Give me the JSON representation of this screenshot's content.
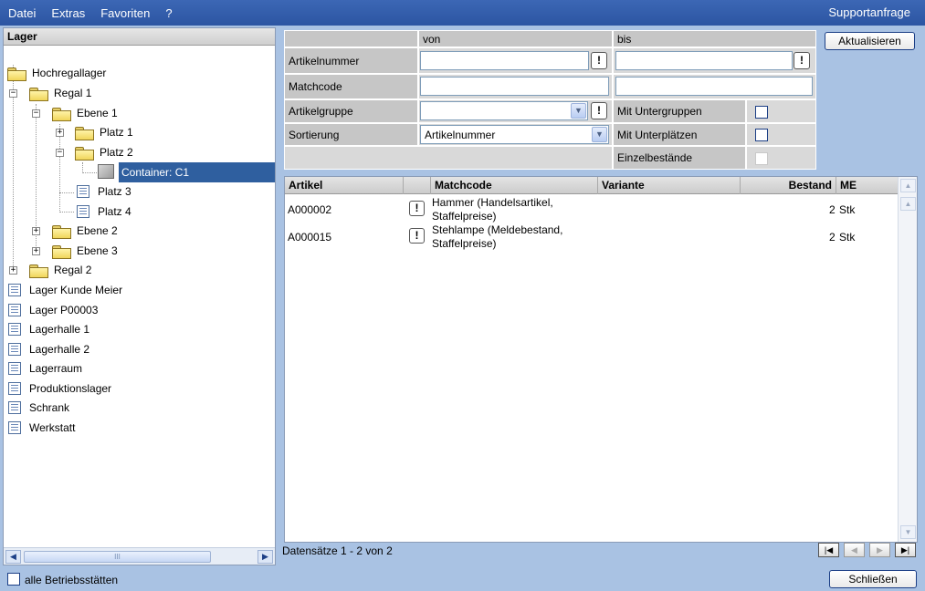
{
  "menubar": {
    "items": [
      "Datei",
      "Extras",
      "Favoriten",
      "?"
    ],
    "support": "Supportanfrage"
  },
  "tree": {
    "header": "Lager",
    "nodes": [
      {
        "label": "Hochregallager",
        "icon": "folder-open-icon"
      },
      {
        "label": "Regal 1",
        "icon": "folder-open-icon"
      },
      {
        "label": "Ebene 1",
        "icon": "folder-open-icon"
      },
      {
        "label": "Platz 1",
        "icon": "folder-icon"
      },
      {
        "label": "Platz 2",
        "icon": "folder-open-icon"
      },
      {
        "label": "Container: C1",
        "icon": "container-icon"
      },
      {
        "label": "Platz 3",
        "icon": "document-icon"
      },
      {
        "label": "Platz 4",
        "icon": "document-icon"
      },
      {
        "label": "Ebene 2",
        "icon": "folder-icon"
      },
      {
        "label": "Ebene 3",
        "icon": "folder-icon"
      },
      {
        "label": "Regal 2",
        "icon": "folder-icon"
      },
      {
        "label": "Lager Kunde Meier",
        "icon": "document-icon"
      },
      {
        "label": "Lager P00003",
        "icon": "document-icon"
      },
      {
        "label": "Lagerhalle 1",
        "icon": "document-icon"
      },
      {
        "label": "Lagerhalle 2",
        "icon": "document-icon"
      },
      {
        "label": "Lagerraum",
        "icon": "document-icon"
      },
      {
        "label": "Produktionslager",
        "icon": "document-icon"
      },
      {
        "label": "Schrank",
        "icon": "document-icon"
      },
      {
        "label": "Werkstatt",
        "icon": "document-icon"
      }
    ],
    "scroll_thumb": "III"
  },
  "filter": {
    "col_von": "von",
    "col_bis": "bis",
    "artikelnummer": "Artikelnummer",
    "matchcode": "Matchcode",
    "artikelgruppe": "Artikelgruppe",
    "sortierung": "Sortierung",
    "sortierung_value": "Artikelnummer",
    "mit_untergruppen": "Mit Untergruppen",
    "mit_unterplaetzen": "Mit Unterplätzen",
    "einzelbestaende": "Einzelbestände",
    "warn_symbol": "!"
  },
  "buttons": {
    "refresh": "Aktualisieren",
    "close": "Schließen"
  },
  "table": {
    "columns": [
      "Artikel",
      "",
      "Matchcode",
      "Variante",
      "Bestand",
      "ME"
    ],
    "rows": [
      {
        "artikel": "A000002",
        "matchcode_line1": "Hammer (Handelsartikel,",
        "matchcode_line2": "Staffelpreise)",
        "variante": "",
        "bestand": "2",
        "me": "Stk"
      },
      {
        "artikel": "A000015",
        "matchcode_line1": "Stehlampe (Meldebestand,",
        "matchcode_line2": "Staffelpreise)",
        "variante": "",
        "bestand": "2",
        "me": "Stk"
      }
    ]
  },
  "status": "Datensätze 1 - 2 von 2",
  "bottom": {
    "all_sites": "alle Betriebsstätten"
  }
}
